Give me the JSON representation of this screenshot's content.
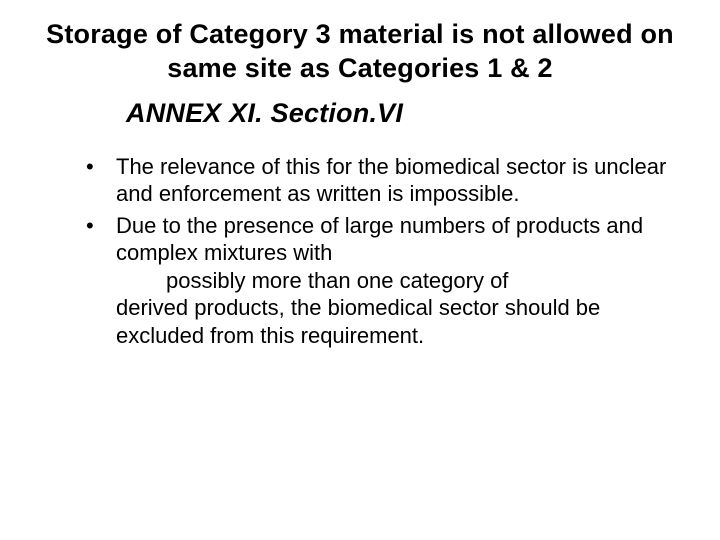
{
  "title": "Storage of Category 3 material is not allowed on same site as Categories 1 & 2",
  "subtitle": "ANNEX XI. Section.VI",
  "bullets": [
    {
      "text": "The relevance of this for the biomedical sector is unclear and enforcement as written is impossible."
    },
    {
      "text_a": "Due to the presence of large numbers of products and complex mixtures with",
      "text_indent": "possibly more than one category of",
      "text_b": "derived products, the biomedical sector should be excluded from this requirement."
    }
  ]
}
